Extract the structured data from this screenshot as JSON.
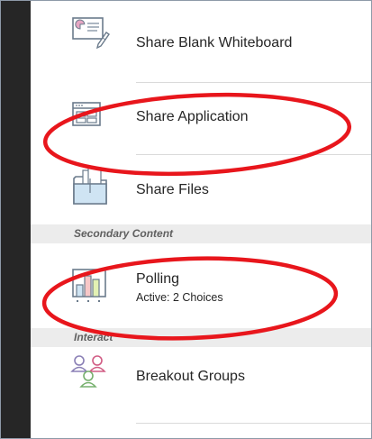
{
  "panel": {
    "items_top": [
      {
        "label": "Share Blank Whiteboard",
        "icon": "whiteboard-icon"
      },
      {
        "label": "Share Application",
        "icon": "application-window-icon"
      },
      {
        "label": "Share Files",
        "icon": "folder-icon"
      }
    ],
    "secondary_header": "Secondary Content",
    "polling": {
      "label": "Polling",
      "status": "Active: 2 Choices",
      "icon": "bar-chart-icon"
    },
    "interact_header": "Interact",
    "breakout": {
      "label": "Breakout Groups",
      "icon": "people-group-icon"
    }
  },
  "colors": {
    "rail": "#262626",
    "annotation_red": "#e8161c",
    "section_header_bg": "#ececec"
  }
}
